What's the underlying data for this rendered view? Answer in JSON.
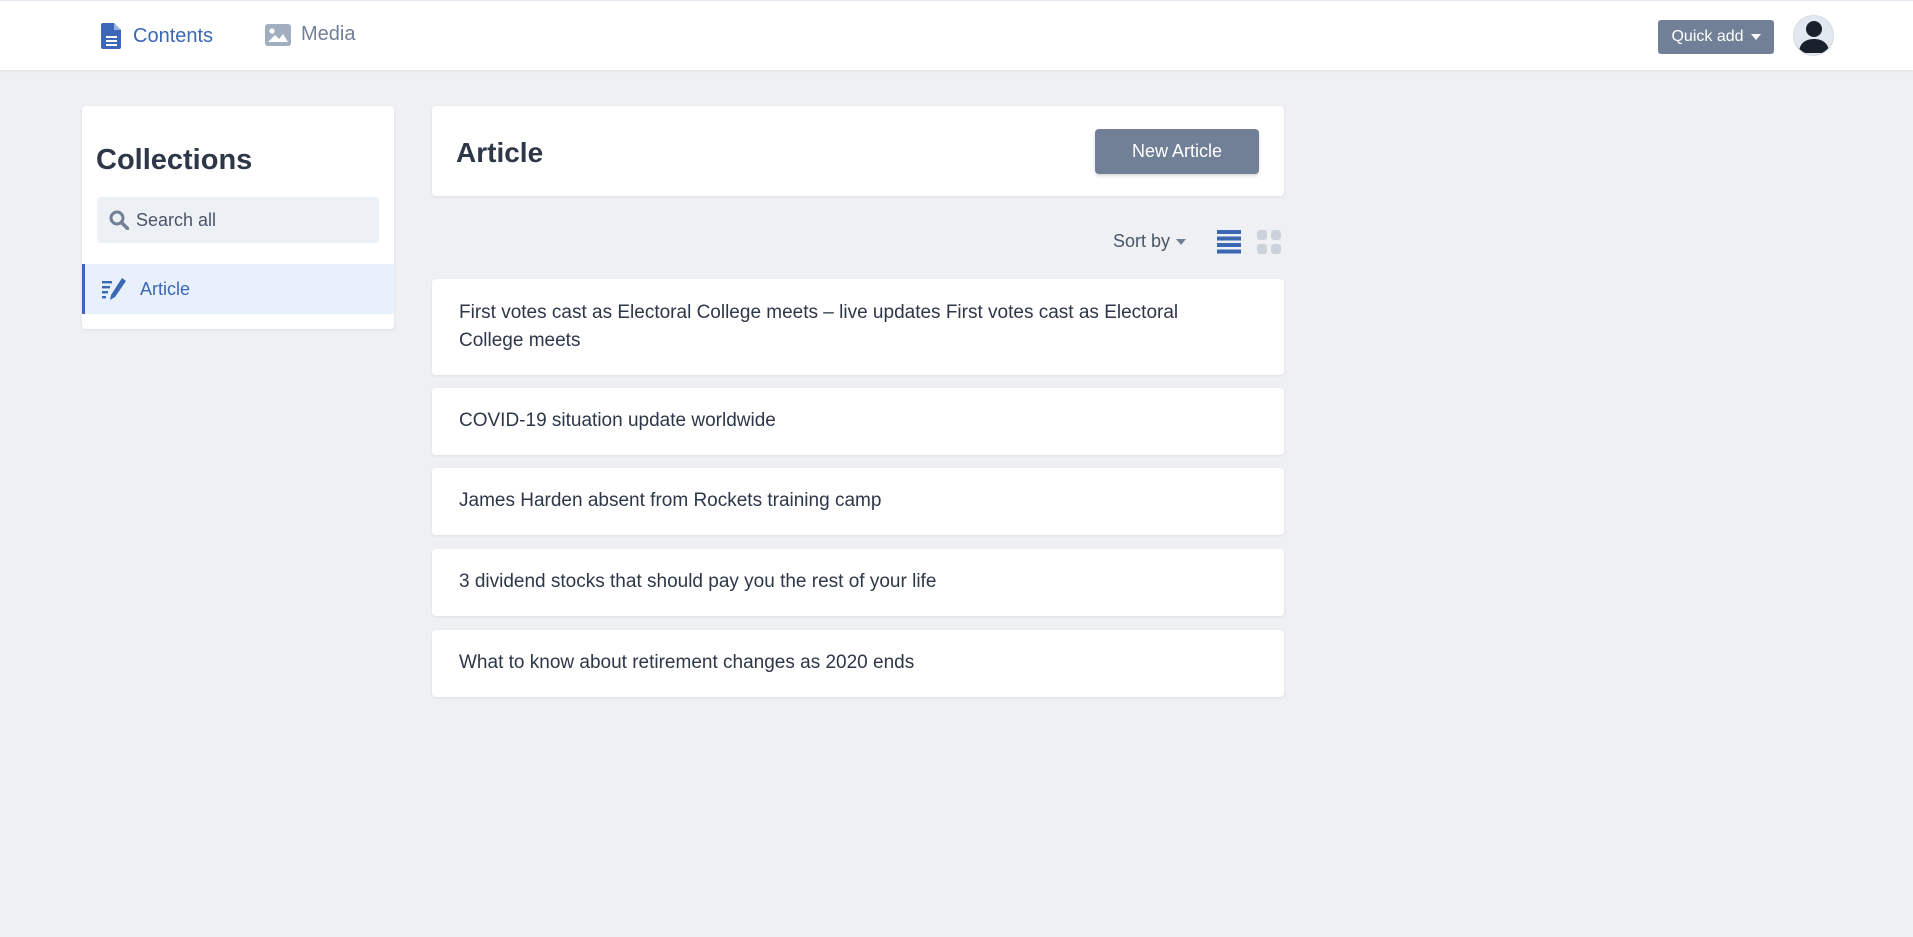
{
  "nav": {
    "tabs": [
      {
        "label": "Contents",
        "icon": "document-icon",
        "active": true
      },
      {
        "label": "Media",
        "icon": "image-icon",
        "active": false
      }
    ],
    "quick_add_label": "Quick add",
    "avatar_icon": "user-icon"
  },
  "sidebar": {
    "title": "Collections",
    "search_placeholder": "Search all",
    "items": [
      {
        "label": "Article",
        "icon": "article-edit-icon",
        "active": true
      }
    ]
  },
  "main": {
    "title": "Article",
    "new_button_label": "New Article",
    "sort_label": "Sort by",
    "view_modes": [
      "list-view-icon",
      "grid-view-icon"
    ],
    "articles": [
      "First votes cast as Electoral College meets – live updates First votes cast as Electoral College meets",
      "COVID-19 situation update worldwide",
      "James Harden absent from Rockets training camp",
      "3 dividend stocks that should pay you the rest of your life",
      "What to know about retirement changes as 2020 ends"
    ]
  },
  "colors": {
    "accent": "#3b67b5",
    "button": "#718096",
    "background": "#eef0f4",
    "active_item_bg": "#e8f1fb"
  }
}
